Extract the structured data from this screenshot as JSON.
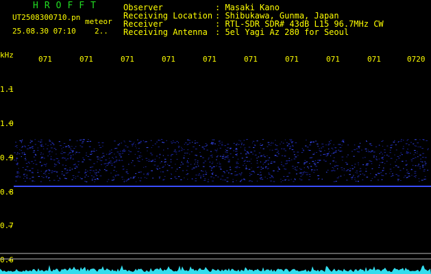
{
  "header": {
    "brand": "HROFFT",
    "file_name": "UT2508300710.pn",
    "tag": "meteor",
    "datetime": "25.08.30 07:10",
    "counter": "2..",
    "observer_label": "Observer",
    "observer_value": ": Masaki Kano",
    "location_label": "Receiving Location",
    "location_value": ": Shibukawa, Gunma, Japan",
    "receiver_label": "Receiver",
    "receiver_value": ": RTL-SDR SDR# 43dB L15 96.7MHz CW",
    "antenna_label": "Receiving Antenna",
    "antenna_value": ": 5el Yagi Az 280 for Seoul"
  },
  "axis": {
    "y_unit": "kHz",
    "y_ticks": [
      "1.1",
      "1.0",
      "0.9",
      "0.8",
      "0.7",
      "0.6"
    ],
    "x_ticks": [
      "071",
      "071",
      "071",
      "071",
      "071",
      "071",
      "071",
      "071",
      "071",
      "0720"
    ]
  },
  "colors": {
    "text": "#ffff00",
    "brand": "#22dd22",
    "signal": "#3a4dff",
    "noise": "#1a2399",
    "waveform": "#33ddee",
    "frame": "#bbbbbb"
  }
}
